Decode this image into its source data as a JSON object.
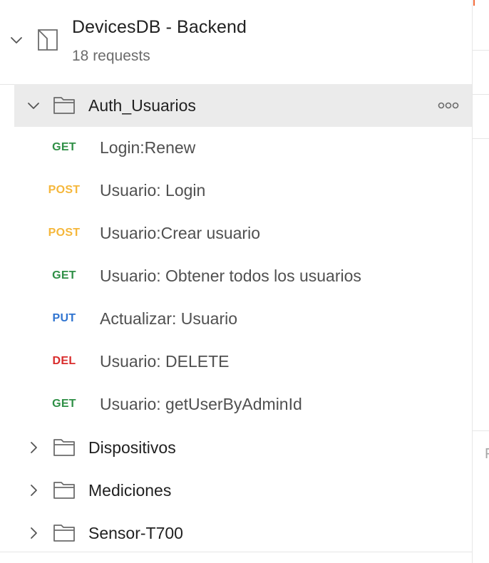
{
  "collection": {
    "name": "DevicesDB - Backend",
    "count": "18 requests"
  },
  "folders": {
    "auth": {
      "name": "Auth_Usuarios",
      "expanded": true
    },
    "dispositivos": {
      "name": "Dispositivos"
    },
    "mediciones": {
      "name": "Mediciones"
    },
    "sensor": {
      "name": "Sensor-T700"
    }
  },
  "requests": [
    {
      "method": "GET",
      "name": "Login:Renew",
      "color": "#2f8f46"
    },
    {
      "method": "POST",
      "name": "Usuario: Login",
      "color": "#f5b73b"
    },
    {
      "method": "POST",
      "name": "Usuario:Crear usuario",
      "color": "#f5b73b"
    },
    {
      "method": "GET",
      "name": "Usuario: Obtener todos los usuarios",
      "color": "#2f8f46"
    },
    {
      "method": "PUT",
      "name": "Actualizar: Usuario",
      "color": "#2f74d0"
    },
    {
      "method": "DEL",
      "name": "Usuario: DELETE",
      "color": "#d92b2b"
    },
    {
      "method": "GET",
      "name": "Usuario: getUserByAdminId",
      "color": "#2f8f46"
    }
  ],
  "right_pane": {
    "partial_letter": "F"
  },
  "icons": {
    "collection": "collection-icon",
    "folder": "folder-icon",
    "chevron_down": "chevron-down-icon",
    "chevron_right": "chevron-right-icon",
    "more": "more-options-icon"
  }
}
